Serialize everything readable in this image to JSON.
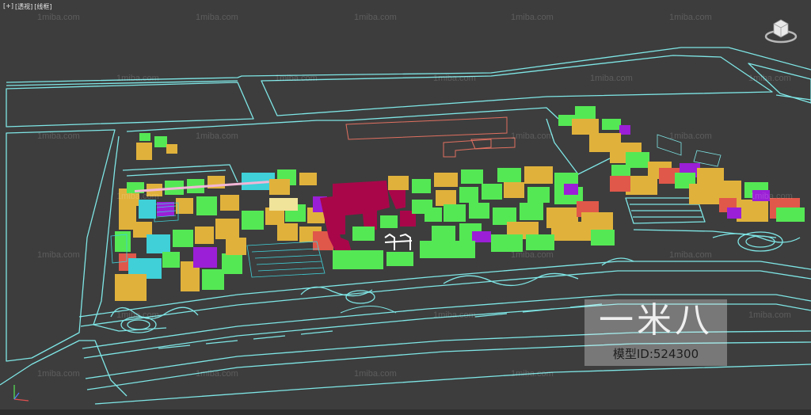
{
  "viewport": {
    "labels": [
      "[+]",
      "[透视]",
      "[线框]"
    ],
    "view_cube_icon": "view-cube-icon",
    "axis_icon": "axis-tripod-icon"
  },
  "watermarks": {
    "site": "1miba.com",
    "brand_logo": "一米八",
    "model_id": "模型ID:524300"
  },
  "colors": {
    "background": "#3d3d3d",
    "road_lines": "#7fe6e6",
    "building_green": "#55e855",
    "building_yellow": "#e0b23c",
    "building_magenta": "#a9064a",
    "building_purple": "#9b1fd6",
    "building_cyan": "#3fd0d8",
    "building_red": "#e0584a"
  }
}
